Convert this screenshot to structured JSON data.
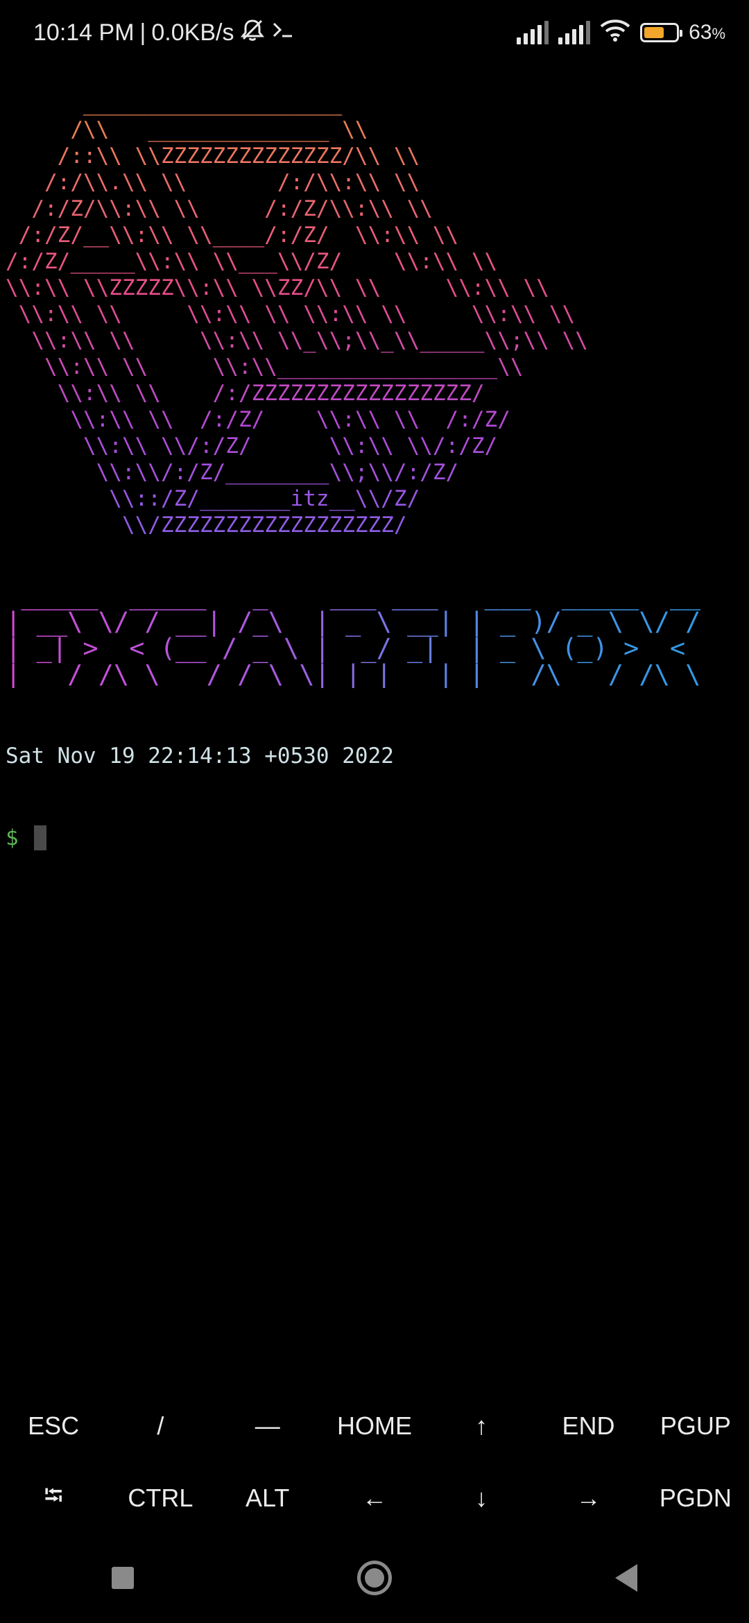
{
  "status_bar": {
    "time": "10:14 PM",
    "separator": "|",
    "net_speed": "0.0KB/s",
    "battery_percent": "63",
    "battery_unit": "%",
    "battery_level": 0.63,
    "battery_color": "#f2a62b",
    "icons": [
      "bell-off-icon",
      "terminal-icon",
      "signal-icon",
      "signal-icon",
      "wifi-icon",
      "battery-icon"
    ]
  },
  "terminal": {
    "logo_ascii": "      ____________________\n     /\\\\   ______________ \\\\\n    /::\\\\ \\\\ZZZZZZZZZZZZZZ/\\\\ \\\\\n   /:/\\\\.\\\\ \\\\       /:/\\\\:\\\\ \\\\\n  /:/Z/\\\\:\\\\ \\\\     /:/Z/\\\\:\\\\ \\\\\n /:/Z/__\\\\:\\\\ \\\\____/:/Z/  \\\\:\\\\ \\\\\n/:/Z/_____\\\\:\\\\ \\\\___\\\\/Z/    \\\\:\\\\ \\\\\n\\\\:\\\\ \\\\ZZZZZ\\\\:\\\\ \\\\ZZ/\\\\ \\\\     \\\\:\\\\ \\\\\n \\\\:\\\\ \\\\     \\\\:\\\\ \\\\ \\\\:\\\\ \\\\     \\\\:\\\\ \\\\\n  \\\\:\\\\ \\\\     \\\\:\\\\ \\\\_\\\\;\\\\_\\\\_____\\\\;\\\\ \\\\\n   \\\\:\\\\ \\\\     \\\\:\\\\_________________\\\\\n    \\\\:\\\\ \\\\    /:/ZZZZZZZZZZZZZZZZZ/\n     \\\\:\\\\ \\\\  /:/Z/    \\\\:\\\\ \\\\  /:/Z/\n      \\\\:\\\\ \\\\/:/Z/      \\\\:\\\\ \\\\/:/Z/\n       \\\\:\\\\/:/Z/________\\\\;\\\\/:/Z/\n        \\\\::/Z/_______itz__\\\\/Z/\n         \\\\/ZZZZZZZZZZZZZZZZZZ/",
    "banner_ascii": " _____  _____   _    ___ ___   ___  _____  __\n| __\\ \\/ / __| /_\\  | _ \\ __| | _ )/ _ \\ \\/ /\n| _| >  < (__ / _ \\ |  _/ _|  | _ \\ (_) >  < \n|___/_/\\_\\___/_/ \\_\\|_| |___| |___/\\___/_/\\_\\",
    "date_line": "Sat Nov 19 22:14:13 +0530 2022",
    "prompt_symbol": "$",
    "prompt_color": "#5ab552"
  },
  "extra_keys": {
    "row1": [
      "ESC",
      "/",
      "—",
      "HOME",
      "↑",
      "END",
      "PGUP"
    ],
    "row2": [
      "⭾",
      "CTRL",
      "ALT",
      "←",
      "↓",
      "→",
      "PGDN"
    ]
  },
  "nav_bar": {
    "icons": [
      "recents-icon",
      "home-icon",
      "back-icon"
    ]
  }
}
